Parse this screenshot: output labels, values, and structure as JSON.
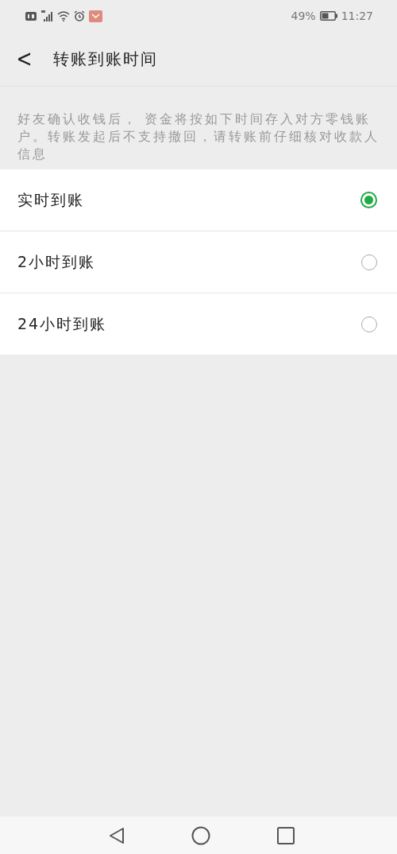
{
  "status_bar": {
    "battery": "49%",
    "time": "11:27"
  },
  "header": {
    "back_icon": "<",
    "title": "转账到账时间"
  },
  "description": "好友确认收钱后， 资金将按如下时间存入对方零钱账户。转账发起后不支持撤回，请转账前仔细核对收款人信息",
  "options": [
    {
      "label": "实时到账",
      "selected": true
    },
    {
      "label": "2小时到账",
      "selected": false
    },
    {
      "label": "24小时到账",
      "selected": false
    }
  ]
}
